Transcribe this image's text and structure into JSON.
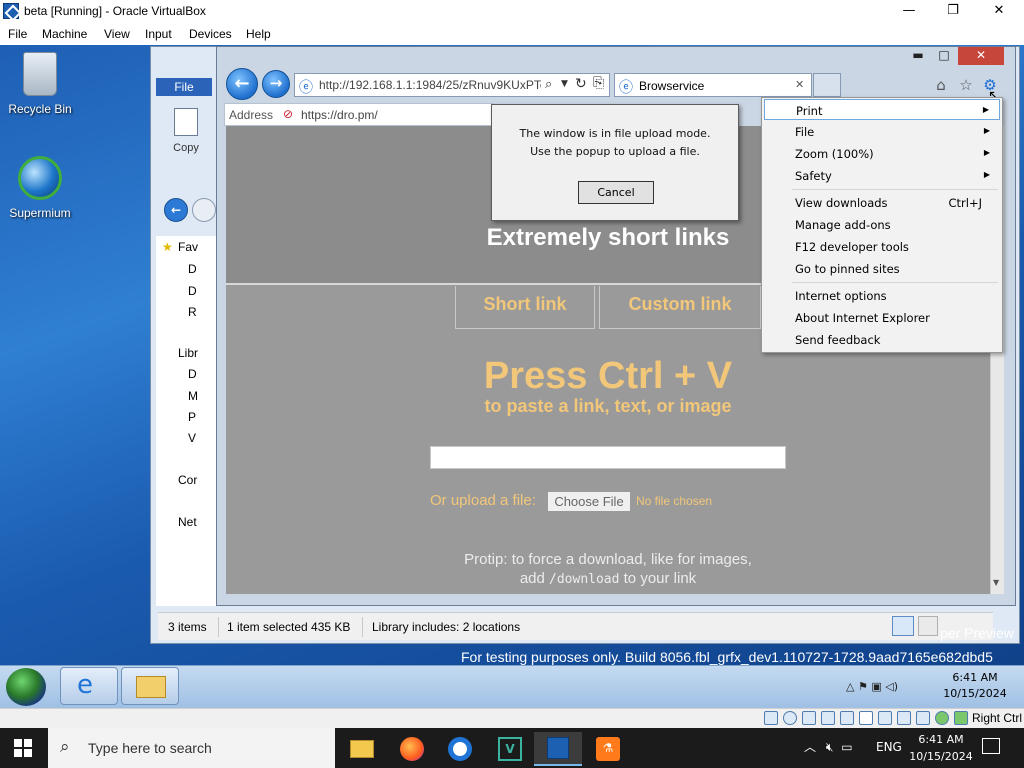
{
  "host_window": {
    "title": "beta [Running] - Oracle VirtualBox",
    "controls": {
      "minimize": "—",
      "maximize": "❐",
      "close": "✕"
    },
    "menu": [
      "File",
      "Machine",
      "View",
      "Input",
      "Devices",
      "Help"
    ]
  },
  "desktop_icons": [
    {
      "label": "Recycle Bin",
      "icon": "recycle-bin-icon"
    },
    {
      "label": "Supermium",
      "icon": "supermium-icon"
    }
  ],
  "explorer": {
    "ribbon_tab": "File",
    "copy_label": "Copy",
    "sidebar": [
      "Fav",
      "D",
      "D",
      "R",
      "Libr",
      "D",
      "M",
      "P",
      "V",
      "Cor",
      "Net"
    ],
    "status": {
      "items": "3 items",
      "selected": "1 item selected  435 KB",
      "library": "Library includes: 2 locations"
    }
  },
  "ie": {
    "address_url": "http://192.168.1.1:1984/25/zRnuv9KUxPTc",
    "tab_title": "Browservice",
    "inner_address_label": "Address",
    "inner_address_url": "https://dro.pm/",
    "popup": {
      "line1": "The window is in file upload mode.",
      "line2": "Use the popup to upload a file.",
      "cancel": "Cancel"
    },
    "page": {
      "headline": "Extremely short links",
      "tab_short": "Short link",
      "tab_custom": "Custom link",
      "press": "Press Ctrl + V",
      "paste_hint": "to paste a link, text, or image",
      "upload_label": "Or upload a file:",
      "choose_file": "Choose File",
      "no_file": "No file chosen",
      "protip_line1": "Protip: to force a download, like for images,",
      "protip_pre": "add",
      "protip_code": "/download",
      "protip_post": "to your link"
    },
    "tools_menu": [
      {
        "label": "Print",
        "submenu": true,
        "highlight": true
      },
      {
        "label": "File",
        "submenu": true
      },
      {
        "label": "Zoom (100%)",
        "submenu": true
      },
      {
        "label": "Safety",
        "submenu": true
      },
      {
        "label": "View downloads",
        "shortcut": "Ctrl+J"
      },
      {
        "label": "Manage add-ons"
      },
      {
        "label": "F12 developer tools"
      },
      {
        "label": "Go to pinned sites"
      },
      {
        "label": "Internet options"
      },
      {
        "label": "About Internet Explorer"
      },
      {
        "label": "Send feedback"
      }
    ]
  },
  "watermark": {
    "line1": "per Preview",
    "line2": "For testing purposes only. Build 8056.fbl_grfx_dev1.110727-1728.9aad7165e682dbd5"
  },
  "guest_tray": {
    "time": "6:41 AM",
    "date": "10/15/2024"
  },
  "vbox_status": {
    "host_key": "Right Ctrl"
  },
  "host_taskbar": {
    "search_placeholder": "Type here to search",
    "lang": "ENG",
    "time": "6:41 AM",
    "date": "10/15/2024"
  }
}
